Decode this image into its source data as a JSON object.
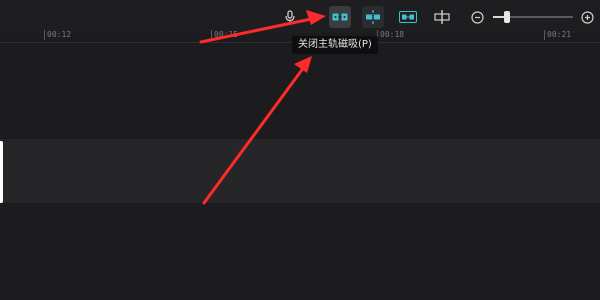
{
  "toolbar": {
    "tools": [
      {
        "icon": "microphone-icon"
      },
      {
        "icon": "main-track-magnet-icon",
        "active": true
      },
      {
        "icon": "auto-snap-icon"
      },
      {
        "icon": "linkage-icon"
      },
      {
        "icon": "split-preview-icon"
      }
    ],
    "zoom": {
      "out_icon": "zoom-out-icon",
      "in_icon": "zoom-in-icon",
      "level": 0.18
    }
  },
  "tooltip": {
    "text": "关闭主轨磁吸(P)"
  },
  "ruler": {
    "labels": [
      "00:12",
      "00:15",
      "00:18",
      "00:21"
    ]
  },
  "colors": {
    "background": "#1c1c1e",
    "active_tool_bg": "#3a3c40",
    "icon_accent": "#3fc1cf",
    "annotation_arrow": "#ff2a2a"
  }
}
